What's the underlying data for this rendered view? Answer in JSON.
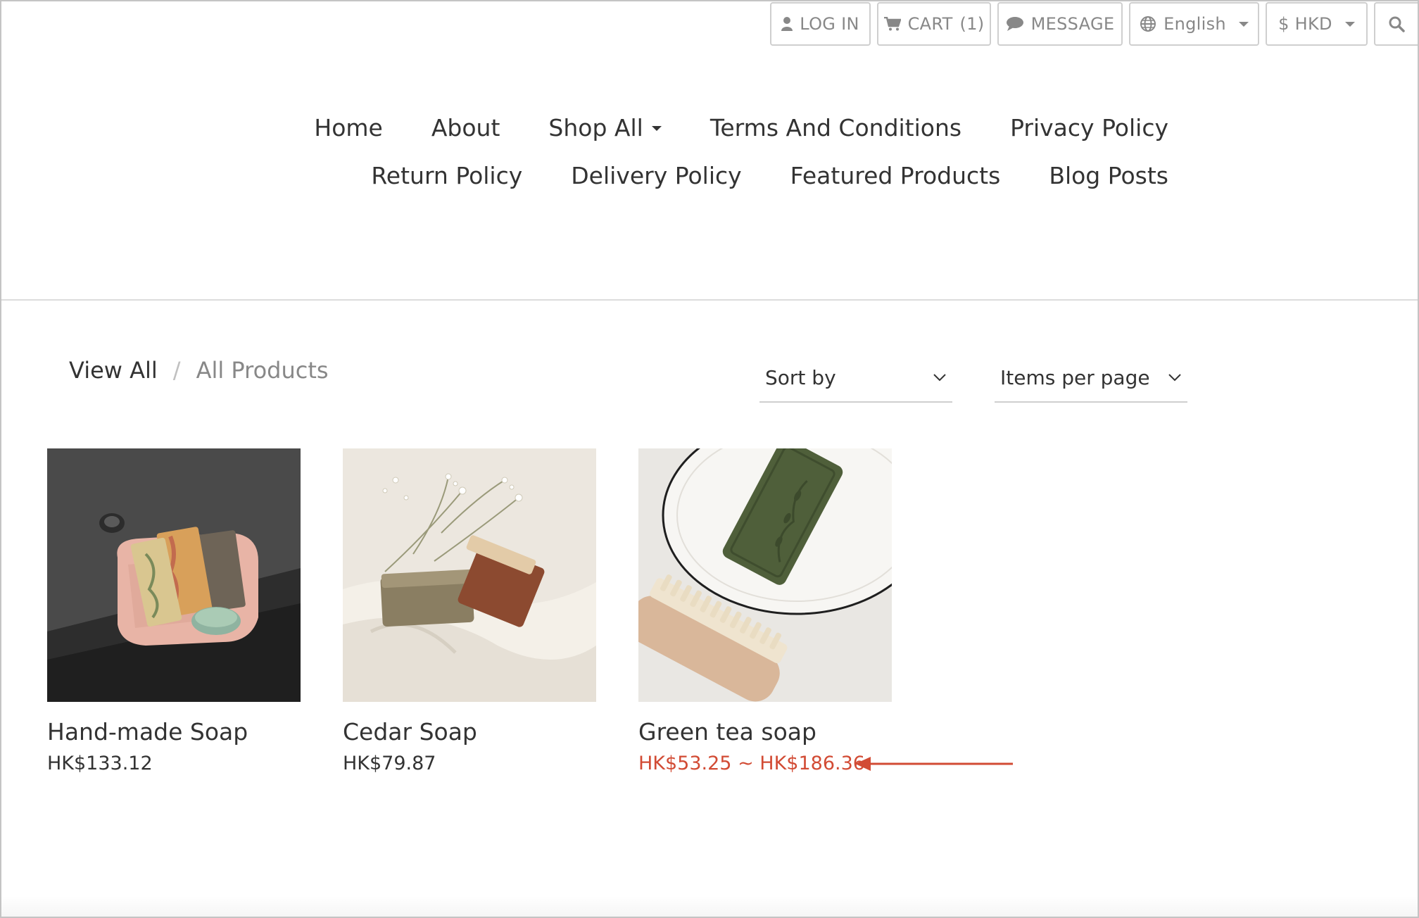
{
  "topbar": {
    "login_label": "LOG IN",
    "cart_label": "CART",
    "cart_count": "(1)",
    "message_label": "MESSAGE",
    "language_label": "English",
    "currency_label": "$ HKD",
    "icons": [
      "user-icon",
      "cart-icon",
      "chat-icon",
      "globe-icon",
      "search-icon"
    ]
  },
  "nav": {
    "items": [
      {
        "label": "Home"
      },
      {
        "label": "About"
      },
      {
        "label": "Shop All"
      },
      {
        "label": "Terms And Conditions"
      },
      {
        "label": "Privacy Policy"
      },
      {
        "label": "Return Policy"
      },
      {
        "label": "Delivery Policy"
      },
      {
        "label": "Featured Products"
      },
      {
        "label": "Blog Posts"
      }
    ]
  },
  "breadcrumb": {
    "current": "View All",
    "separator": "/",
    "last": "All Products"
  },
  "filters": {
    "sort_label": "Sort by",
    "per_page_label": "Items per page"
  },
  "products": [
    {
      "name": "Hand-made Soap",
      "price": "HK$133.12"
    },
    {
      "name": "Cedar Soap",
      "price": "HK$79.87"
    },
    {
      "name": "Green tea soap",
      "price": "HK$53.25 ~ HK$186.36"
    }
  ],
  "colors": {
    "text": "#333333",
    "muted": "#888888",
    "highlight": "#d24b34",
    "border": "#cfcfcf"
  }
}
